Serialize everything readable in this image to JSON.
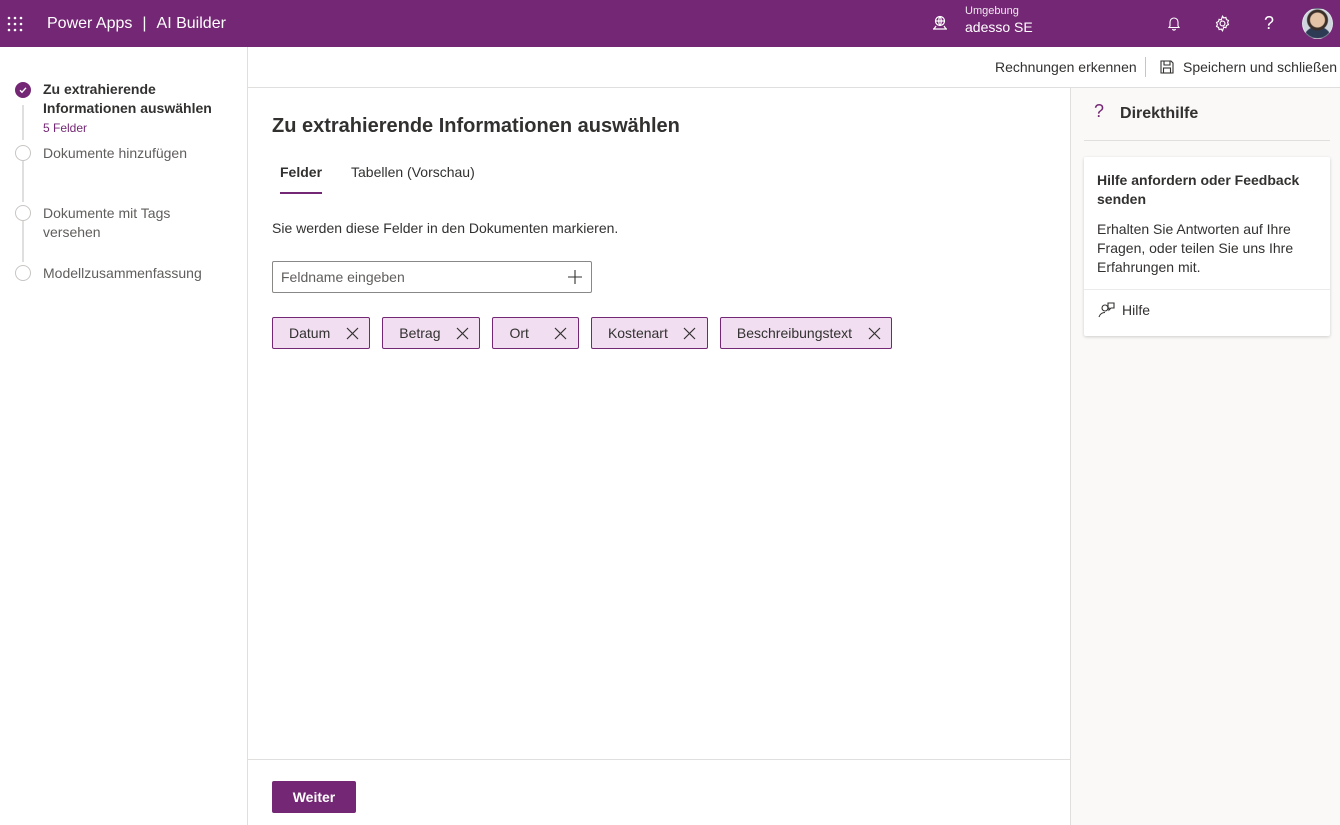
{
  "topbar": {
    "app_name": "Power Apps",
    "separator": "|",
    "product": "AI Builder",
    "environment_label": "Umgebung",
    "environment_name": "adesso SE",
    "icons": [
      "waffle-icon",
      "environment-icon",
      "bell-icon",
      "gear-icon",
      "help-icon",
      "avatar"
    ],
    "accent": "#742774"
  },
  "steps": [
    {
      "label": "Zu extrahierende Informationen auswählen",
      "sub": "5 Felder",
      "status": "done"
    },
    {
      "label": "Dokumente hinzufügen",
      "status": "todo"
    },
    {
      "label": "Dokumente mit Tags versehen",
      "status": "todo"
    },
    {
      "label": "Modellzusammenfassung",
      "status": "todo"
    }
  ],
  "commands": {
    "recognize": "Rechnungen erkennen",
    "save_close": "Speichern und schließen"
  },
  "main": {
    "title": "Zu extrahierende Informationen auswählen",
    "tabs": [
      {
        "label": "Felder",
        "active": true
      },
      {
        "label": "Tabellen (Vorschau)",
        "active": false
      }
    ],
    "description": "Sie werden diese Felder in den Dokumenten markieren.",
    "input_placeholder": "Feldname eingeben",
    "input_value": "",
    "fields": [
      "Datum",
      "Betrag",
      "Ort",
      "Kostenart",
      "Beschreibungstext"
    ],
    "next_button": "Weiter"
  },
  "help": {
    "title": "Direkthilfe",
    "card_title": "Hilfe anfordern oder Feedback senden",
    "card_text": "Erhalten Sie Antworten auf Ihre Fragen, oder teilen Sie uns Ihre Erfahrungen mit.",
    "link": "Hilfe"
  }
}
